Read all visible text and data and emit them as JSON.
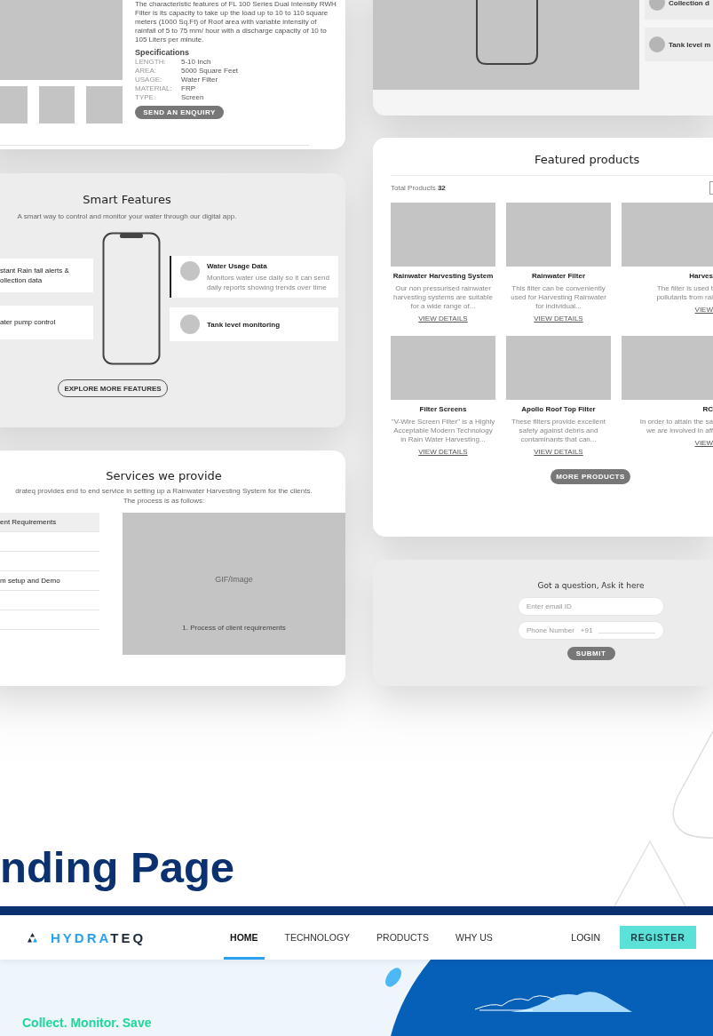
{
  "product_detail": {
    "description": "The characteristic features of FL 100 Series Dual Intensity RWH Filter is its capacity to take up the load up to 10 to 110 square meters (1000 Sq.Ft) of Roof area with variable intensity of rainfall of 5 to 75 mm/ hour with a discharge capacity of 10 to 105 Liters per minute.",
    "specs_title": "Specifications",
    "specs": [
      {
        "label": "LENGTH:",
        "value": "5-10 Inch"
      },
      {
        "label": "AREA:",
        "value": "5000 Square Feet"
      },
      {
        "label": "USAGE:",
        "value": "Water Filter"
      },
      {
        "label": "MATERIAL:",
        "value": "FRP"
      },
      {
        "label": "TYPE:",
        "value": "Screen"
      }
    ],
    "button": "SEND AN ENQUIRY"
  },
  "app_preview": {
    "features": [
      {
        "text": "Collection d"
      },
      {
        "text": "Tank level m"
      }
    ]
  },
  "smart_features": {
    "title": "Smart Features",
    "subtitle": "A smart way to control and monitor your water through our digital app.",
    "left_features": [
      {
        "lines": [
          "stant Rain fall alerts &",
          "ollection data"
        ]
      },
      {
        "lines": [
          "ater pump control"
        ]
      }
    ],
    "right_features": [
      {
        "title": "Water Usage Data",
        "description": "Monitors water use daily so it can send daily reports showing trends over time",
        "selected": true
      },
      {
        "title": "Tank level monitoring",
        "selected": false
      }
    ],
    "button": "EXPLORE MORE FEATURES"
  },
  "services": {
    "title": "Services we provide",
    "description_lines": [
      "drateq provides end to end service in setting up a Rainwater Harvesting System for the clients.",
      "The process is as follows:"
    ],
    "steps": [
      {
        "text": "ent Requirements",
        "selected": true
      },
      {
        "selected": false
      },
      {
        "selected": false
      },
      {
        "text": "m setup and Demo",
        "selected": false
      },
      {
        "selected": false
      },
      {
        "selected": false
      }
    ],
    "media_label": "GIF/Image",
    "media_caption": "1. Process of client requirements"
  },
  "featured_products": {
    "title": "Featured products",
    "total_label": "Total Products",
    "total_count": "32",
    "products": [
      {
        "name": "Rainwater Harvesting System",
        "description": "Our non pressurised rainwater harvesting systems are suitable for a wide range of...",
        "link": "VIEW DETAILS"
      },
      {
        "name": "Rainwater Filter",
        "description": "This filter can be conveniently used for Harvesting Rainwater for individual...",
        "link": "VIEW DETAILS"
      },
      {
        "name": "Harves",
        "description_lines": [
          "The filter is used t",
          "pollutants from rai"
        ],
        "link": "VIEW"
      },
      {
        "name": "Filter Screens",
        "description": "\"V-Wire Screen Filter\" is a Highly Acceptable Modern Technology in Rain Water Harvesting...",
        "link": "VIEW DETAILS"
      },
      {
        "name": "Apollo Roof Top Filter",
        "description": "These filters provide excellent safety against debris and contaminants that can...",
        "link": "VIEW DETAILS"
      },
      {
        "name": "RC",
        "description_lines": [
          "In order to attain the sa",
          "we are involved in aff"
        ],
        "link": "VIEW"
      }
    ],
    "button": "MORE PRODUCTS"
  },
  "question_form": {
    "title": "Got a question, Ask it here",
    "email_placeholder": "Enter email ID",
    "phone_placeholder": "Phone Number",
    "phone_prefix": "+91",
    "button": "SUBMIT"
  },
  "page_heading": "nding Page",
  "site_nav": {
    "logo_primary": "HYDRA",
    "logo_secondary": "TEQ",
    "items": [
      {
        "label": "HOME",
        "selected": true
      },
      {
        "label": "TECHNOLOGY",
        "selected": false
      },
      {
        "label": "PRODUCTS",
        "selected": false
      },
      {
        "label": "WHY US",
        "selected": false
      }
    ],
    "login": "LOGIN",
    "register": "REGISTER"
  },
  "hero": {
    "tagline": "Collect. Monitor. Save"
  }
}
